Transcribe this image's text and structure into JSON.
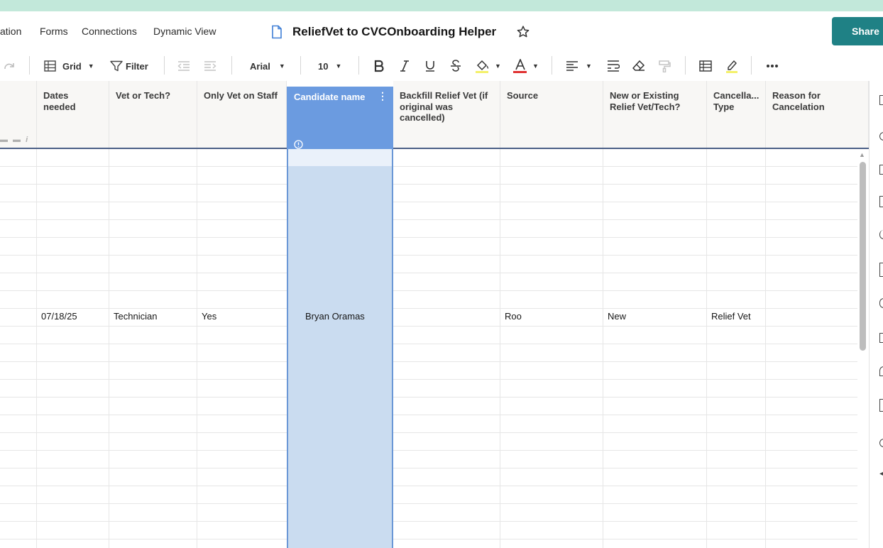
{
  "nav": {
    "items": [
      "ation",
      "Forms",
      "Connections",
      "Dynamic View"
    ]
  },
  "document": {
    "title": "ReliefVet to CVCOnboarding Helper"
  },
  "share": {
    "label": "Share"
  },
  "toolbar": {
    "view_label": "Grid",
    "filter_label": "Filter",
    "font": "Arial",
    "font_size": "10"
  },
  "colors": {
    "accent": "#1f8185",
    "header_band": "#c2e8da",
    "selected_column": "#cadcf0",
    "selected_header": "#6b9be0"
  },
  "columns": [
    {
      "label": "Dates needed"
    },
    {
      "label": "Vet or Tech?"
    },
    {
      "label": "Only Vet on Staff"
    },
    {
      "label": "Candidate name"
    },
    {
      "label": "Backfill Relief Vet (if original was cancelled)"
    },
    {
      "label": "Source"
    },
    {
      "label": "New or Existing Relief Vet/Tech?"
    },
    {
      "label": "Cancella... Type"
    },
    {
      "label": "Reason for Cancelation"
    }
  ],
  "row": {
    "dates_needed": "07/18/25",
    "vet_or_tech": "Technician",
    "only_vet_on_staff": "Yes",
    "candidate_name": "Bryan Oramas",
    "backfill": "",
    "source": "Roo",
    "new_or_existing": "New",
    "cancellation_type": "Relief Vet",
    "reason": ""
  }
}
